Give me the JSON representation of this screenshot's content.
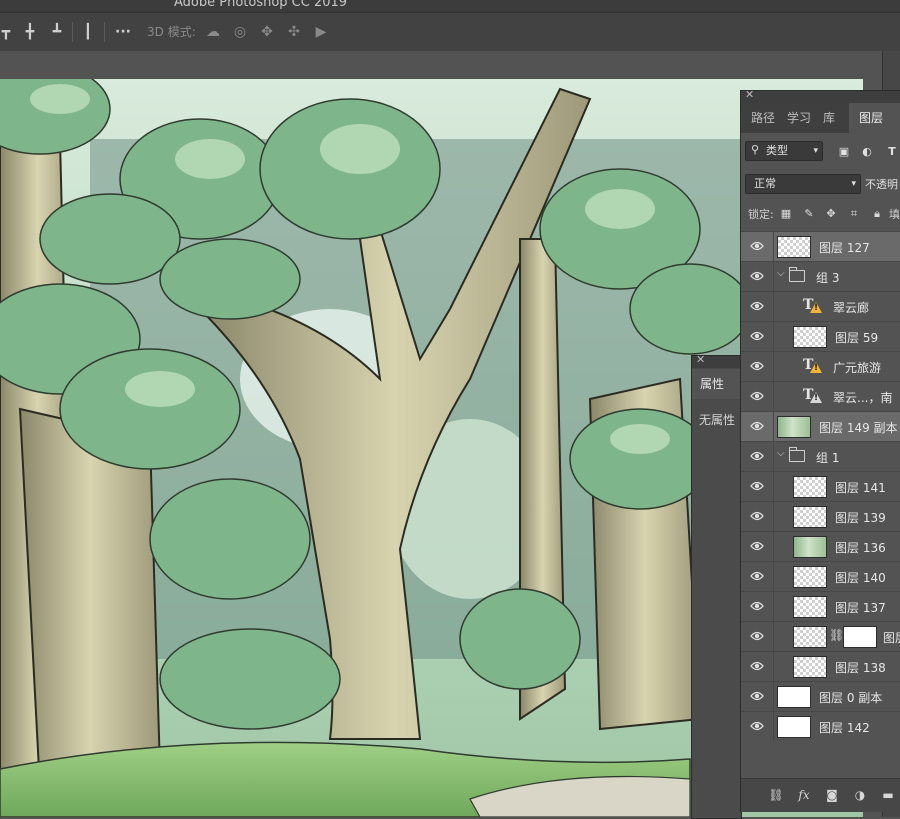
{
  "app": {
    "title": "Adobe Photoshop CC 2019"
  },
  "options_bar": {
    "mode_3d_label": "3D 模式:",
    "icons": [
      "align-top-icon",
      "align-vcenter-icon",
      "align-bottom-icon",
      "distribute-icon",
      "more-icon",
      "orbit-3d-icon",
      "roll-3d-icon",
      "pan-3d-icon",
      "slide-3d-icon",
      "scale-3d-icon"
    ]
  },
  "layers_panel": {
    "tabs": [
      {
        "label": "路径",
        "active": false
      },
      {
        "label": "学习",
        "active": false
      },
      {
        "label": "库",
        "active": false
      },
      {
        "label": "图层",
        "active": true
      }
    ],
    "filter": {
      "kind_label": "类型"
    },
    "blend": {
      "mode": "正常",
      "opacity_label": "不透明"
    },
    "lock": {
      "label": "锁定:",
      "fill_label": "填"
    },
    "layers": [
      {
        "name": "图层 127",
        "type": "pixel",
        "indent": 0,
        "selected": true
      },
      {
        "name": "组 3",
        "type": "group",
        "indent": 0,
        "selected": false
      },
      {
        "name": "翠云廊",
        "type": "text-warning",
        "indent": 1,
        "selected": false
      },
      {
        "name": "图层 59",
        "type": "pixel",
        "indent": 1,
        "selected": false
      },
      {
        "name": "广元旅游",
        "type": "text-warning",
        "indent": 1,
        "selected": false
      },
      {
        "name": "翠云...，南",
        "type": "text-gray",
        "indent": 1,
        "selected": false
      },
      {
        "name": "图层 149 副本",
        "type": "art",
        "indent": 0,
        "selected": true
      },
      {
        "name": "组 1",
        "type": "group",
        "indent": 0,
        "selected": false
      },
      {
        "name": "图层 141",
        "type": "pixel",
        "indent": 1,
        "selected": false
      },
      {
        "name": "图层 139",
        "type": "pixel",
        "indent": 1,
        "selected": false
      },
      {
        "name": "图层 136",
        "type": "art",
        "indent": 1,
        "selected": false
      },
      {
        "name": "图层 140",
        "type": "pixel",
        "indent": 1,
        "selected": false
      },
      {
        "name": "图层 137",
        "type": "pixel",
        "indent": 1,
        "selected": false
      },
      {
        "name": "图层",
        "type": "masked",
        "indent": 1,
        "selected": false
      },
      {
        "name": "图层 138",
        "type": "pixel",
        "indent": 1,
        "selected": false
      },
      {
        "name": "图层 0 副本",
        "type": "white",
        "indent": 0,
        "selected": false
      },
      {
        "name": "图层 142",
        "type": "white",
        "indent": 0,
        "selected": false
      }
    ],
    "bottom_icons": [
      "link-layers-icon",
      "fx-icon",
      "add-mask-icon",
      "adjustment-layer-icon",
      "new-group-icon"
    ]
  },
  "properties_panel": {
    "tab_label": "属性",
    "empty_text": "无属性"
  },
  "colors": {
    "panel_bg": "#535353",
    "toolbar_bg": "#424242",
    "warning_icon": "#f2b632",
    "selected_row": "#6a6a6a"
  }
}
